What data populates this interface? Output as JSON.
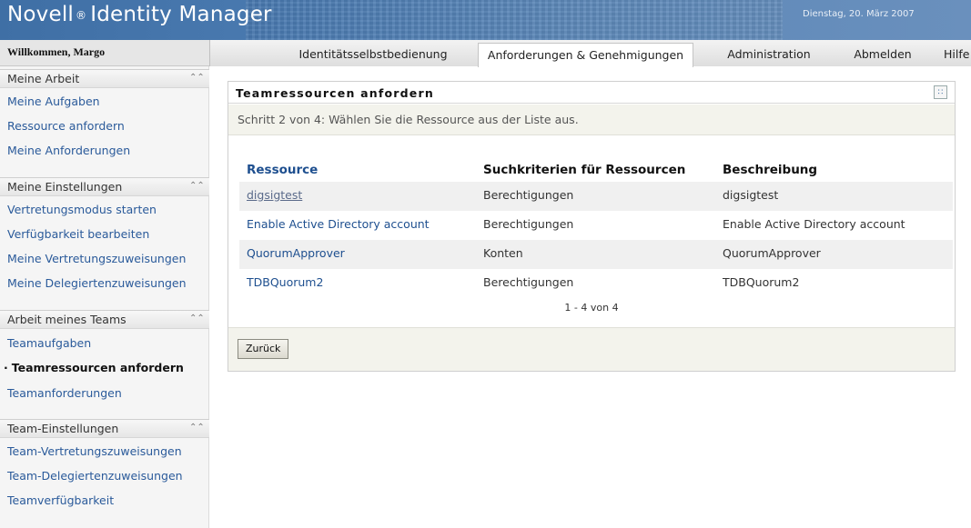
{
  "header": {
    "brand": "Novell",
    "brand_mark": "®",
    "brand_product": "Identity Manager",
    "date": "Dienstag, 20. März 2007"
  },
  "topbar": {
    "welcome": "Willkommen, Margo",
    "tabs": [
      {
        "label": "Identitätsselbstbedienung",
        "active": false
      },
      {
        "label": "Anforderungen & Genehmigungen",
        "active": true
      },
      {
        "label": "Administration",
        "active": false
      },
      {
        "label": "Abmelden",
        "active": false
      },
      {
        "label": "Hilfe",
        "active": false
      }
    ]
  },
  "sidebar": {
    "sections": [
      {
        "title": "Meine Arbeit",
        "items": [
          "Meine Aufgaben",
          "Ressource anfordern",
          "Meine Anforderungen"
        ]
      },
      {
        "title": "Meine Einstellungen",
        "items": [
          "Vertretungsmodus starten",
          "Verfügbarkeit bearbeiten",
          "Meine Vertretungszuweisungen",
          "Meine Delegiertenzuweisungen"
        ]
      },
      {
        "title": "Arbeit meines Teams",
        "items": [
          "Teamaufgaben",
          "Teamressourcen anfordern",
          "Teamanforderungen"
        ]
      },
      {
        "title": "Team-Einstellungen",
        "items": [
          "Team-Vertretungszuweisungen",
          "Team-Delegiertenzuweisungen",
          "Teamverfügbarkeit"
        ]
      }
    ],
    "current_item": "Teamressourcen anfordern"
  },
  "panel": {
    "title": "Teamressourcen anfordern",
    "step_text": "Schritt 2 von 4: Wählen Sie die Ressource aus der Liste aus.",
    "columns": [
      "Ressource",
      "Suchkriterien für Ressourcen",
      "Beschreibung"
    ],
    "rows": [
      {
        "resource": "digsigtest",
        "criteria": "Berechtigungen",
        "description": "digsigtest"
      },
      {
        "resource": "Enable Active Directory account",
        "criteria": "Berechtigungen",
        "description": "Enable Active Directory account"
      },
      {
        "resource": "QuorumApprover",
        "criteria": "Konten",
        "description": "QuorumApprover"
      },
      {
        "resource": "TDBQuorum2",
        "criteria": "Berechtigungen",
        "description": "TDBQuorum2"
      }
    ],
    "paging": "1 - 4 von 4",
    "back_label": "Zurück"
  }
}
